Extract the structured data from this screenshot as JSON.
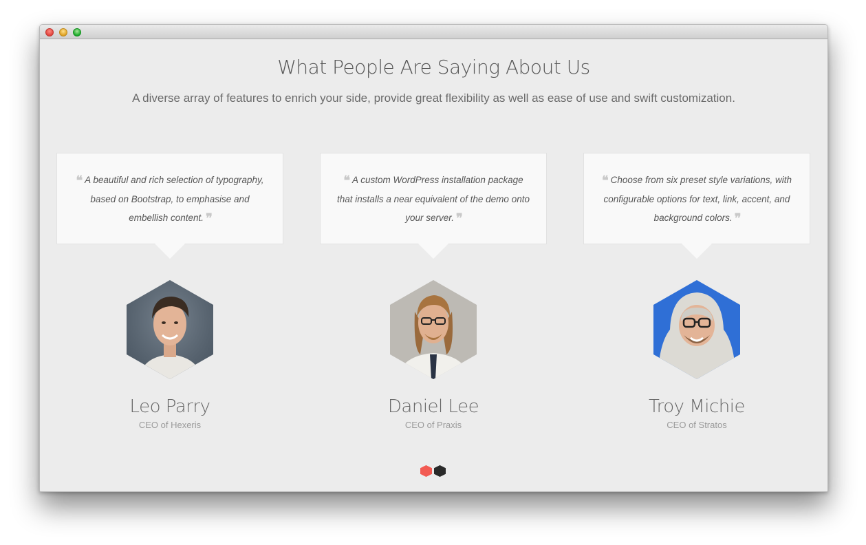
{
  "section": {
    "title": "What People Are Saying About Us",
    "subtitle": "A diverse array of features to enrich your side, provide great flexibility as well as ease of use and swift customization."
  },
  "testimonials": [
    {
      "quote": "A beautiful and rich selection of typography, based on Bootstrap, to emphasise and embellish content.",
      "name": "Leo Parry",
      "role": "CEO of Hexeris",
      "photo_bg": "#5c6a78"
    },
    {
      "quote": "A custom WordPress installation package that installs a near equivalent of the demo onto your server.",
      "name": "Daniel Lee",
      "role": "CEO of Praxis",
      "photo_bg": "#bdbab4"
    },
    {
      "quote": "Choose from six preset style variations, with configurable options for text, link, accent, and background colors.",
      "name": "Troy Michie",
      "role": "CEO of Stratos",
      "photo_bg": "#2f6fd6"
    }
  ],
  "quote_marks": {
    "open": "❝",
    "close": "❞"
  },
  "pagination": {
    "active_color": "#f25a52",
    "inactive_color": "#2a2a2a"
  }
}
